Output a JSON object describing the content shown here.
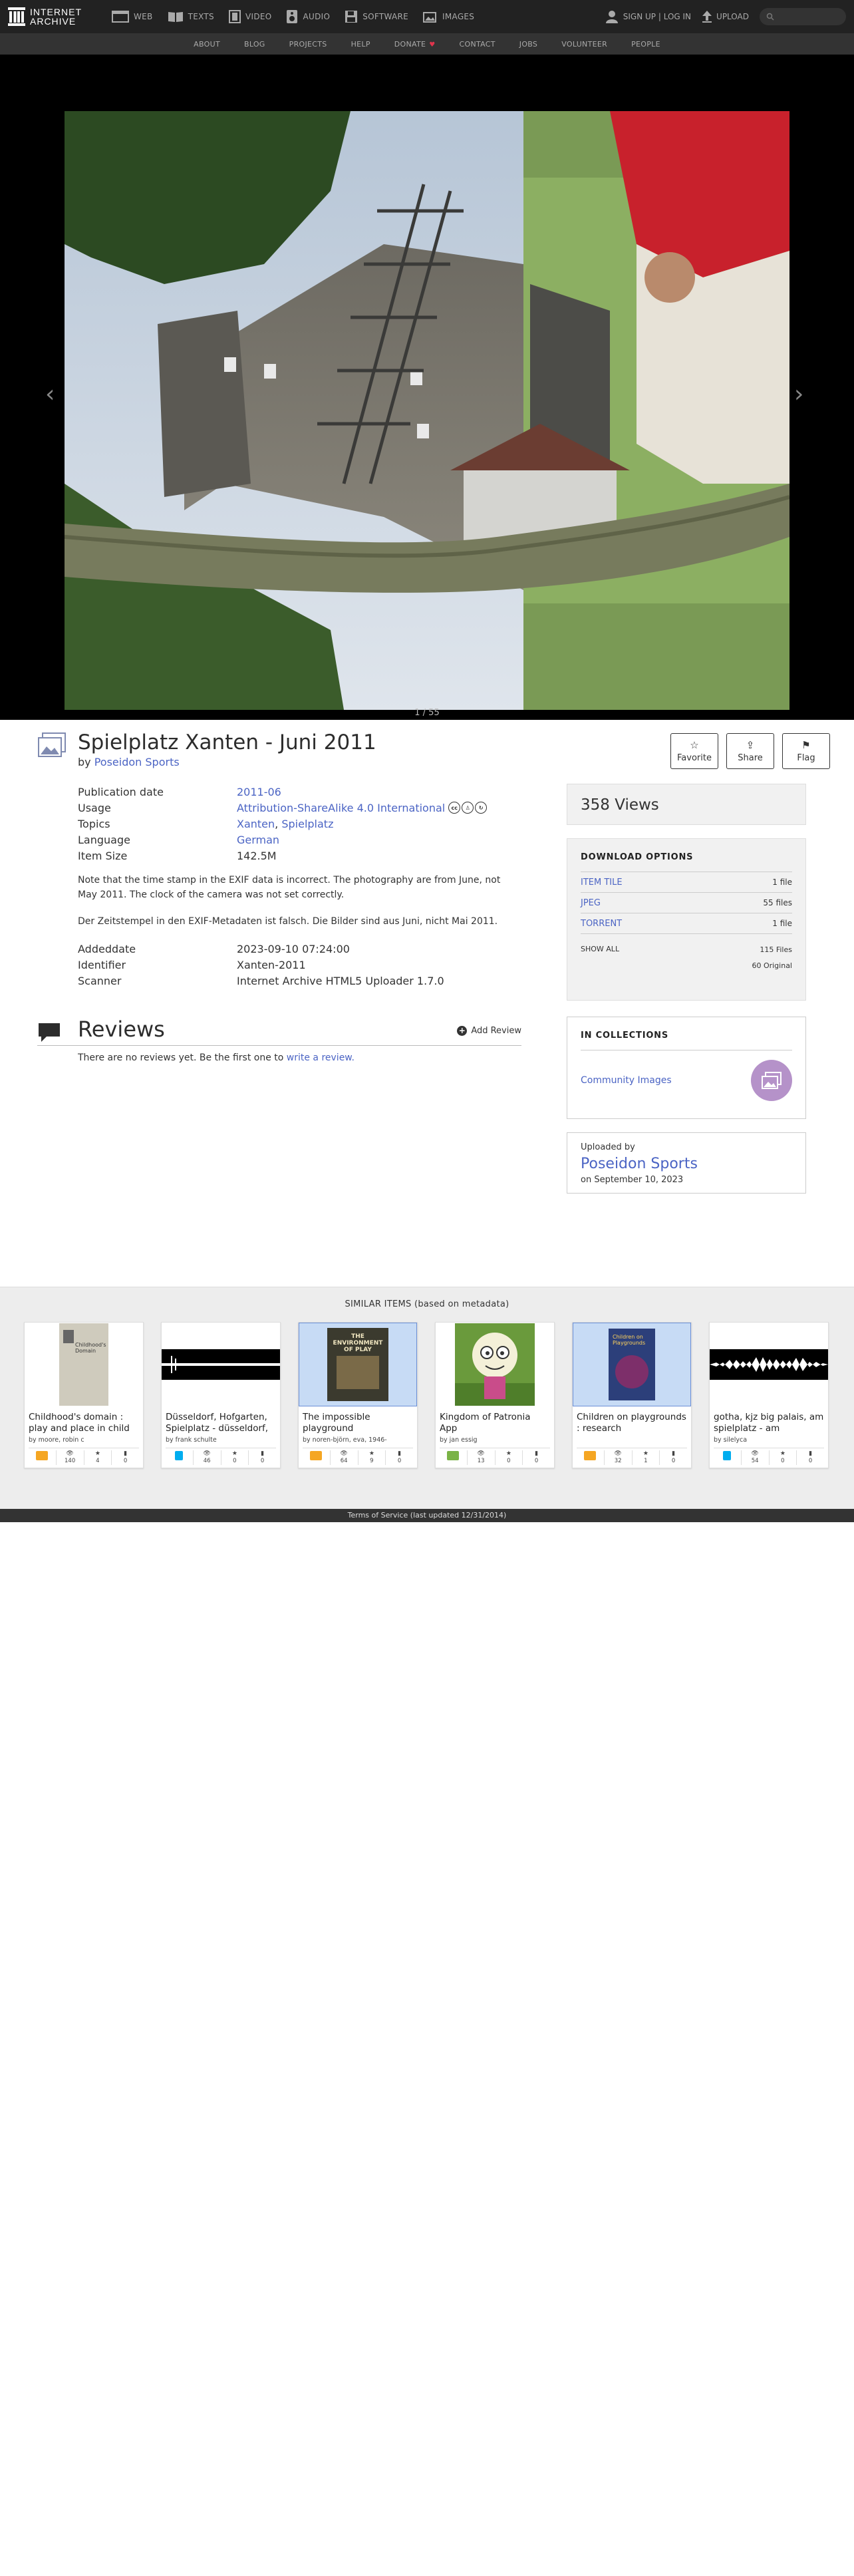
{
  "topnav": {
    "logo_line1": "INTERNET",
    "logo_line2": "ARCHIVE",
    "tabs": [
      {
        "label": "WEB",
        "icon": "web-icon"
      },
      {
        "label": "TEXTS",
        "icon": "book-icon"
      },
      {
        "label": "VIDEO",
        "icon": "film-icon"
      },
      {
        "label": "AUDIO",
        "icon": "speaker-icon"
      },
      {
        "label": "SOFTWARE",
        "icon": "floppy-icon"
      },
      {
        "label": "IMAGES",
        "icon": "images-icon"
      }
    ],
    "signup": "SIGN UP | LOG IN",
    "upload": "UPLOAD"
  },
  "subnav": [
    "ABOUT",
    "BLOG",
    "PROJECTS",
    "HELP",
    "DONATE",
    "CONTACT",
    "JOBS",
    "VOLUNTEER",
    "PEOPLE"
  ],
  "theater": {
    "page_counter": "1 / 55",
    "prev": "‹",
    "next": "›"
  },
  "item": {
    "title": "Spielplatz Xanten - Juni 2011",
    "by_prefix": "by",
    "creator": "Poseidon Sports",
    "metadata": {
      "pubdate_label": "Publication date",
      "pubdate": "2011-06",
      "usage_label": "Usage",
      "usage": "Attribution-ShareAlike 4.0 International",
      "topics_label": "Topics",
      "topic1": "Xanten",
      "topic2": "Spielplatz",
      "language_label": "Language",
      "language": "German",
      "size_label": "Item Size",
      "size": "142.5M"
    },
    "description": [
      "Note that the time stamp in the EXIF data is incorrect. The photography are from June, not May 2011. The clock of the camera was not set correctly.",
      "Der Zeitstempel in den EXIF-Metadaten ist falsch. Die Bilder sind aus Juni, nicht Mai 2011."
    ],
    "metadata2": {
      "addeddate_label": "Addeddate",
      "addeddate": "2023-09-10 07:24:00",
      "identifier_label": "Identifier",
      "identifier": "Xanten-2011",
      "scanner_label": "Scanner",
      "scanner": "Internet Archive HTML5 Uploader 1.7.0"
    }
  },
  "actions": {
    "favorite": "Favorite",
    "share": "Share",
    "flag": "Flag"
  },
  "reviews": {
    "heading": "Reviews",
    "add": "Add Review",
    "empty_text": "There are no reviews yet. Be the first one to",
    "empty_link": "write a review."
  },
  "sidebar": {
    "views": "358 Views",
    "download_heading": "DOWNLOAD OPTIONS",
    "downloads": [
      {
        "label": "ITEM TILE",
        "count": "1 file"
      },
      {
        "label": "JPEG",
        "count": "55 files"
      },
      {
        "label": "TORRENT",
        "count": "1 file"
      }
    ],
    "show_all": "SHOW ALL",
    "total_files": "115 Files",
    "original": "60 Original",
    "collections_heading": "IN COLLECTIONS",
    "collection": "Community Images",
    "uploaded_by_label": "Uploaded by",
    "uploader": "Poseidon Sports",
    "upload_date": "on September 10, 2023"
  },
  "similar": {
    "heading": "SIMILAR ITEMS (based on metadata)",
    "items": [
      {
        "title": "Childhood's domain : play and place in child",
        "by": "by moore, robin c",
        "views": "140",
        "favs": "4",
        "reviews": "0"
      },
      {
        "title": "Düsseldorf, Hofgarten, Spielplatz - düsseldorf,",
        "by": "by frank schulte",
        "views": "46",
        "favs": "0",
        "reviews": "0"
      },
      {
        "title": "The impossible playground",
        "by": "by noren-björn, eva, 1946-",
        "views": "64",
        "favs": "9",
        "reviews": "0"
      },
      {
        "title": "Kingdom of Patronia App",
        "by": "by jan essig",
        "views": "13",
        "favs": "0",
        "reviews": "0"
      },
      {
        "title": "Children on playgrounds : research",
        "by": "",
        "views": "32",
        "favs": "1",
        "reviews": "0"
      },
      {
        "title": "gotha, kjz big palais, am spielplatz - am",
        "by": "by silelyca",
        "views": "54",
        "favs": "0",
        "reviews": "0"
      }
    ],
    "thumb_text_1": "Childhood's Domain",
    "thumb_text_3": "THE ENVIRONMENT OF PLAY",
    "thumb_text_5": "Children on Playgrounds"
  },
  "footer": "Terms of Service (last updated 12/31/2014)",
  "colors": {
    "link": "#4b64c4",
    "nav": "#222222",
    "subnav": "#333333",
    "collection": "#b592c9",
    "heart": "#e0344c"
  }
}
